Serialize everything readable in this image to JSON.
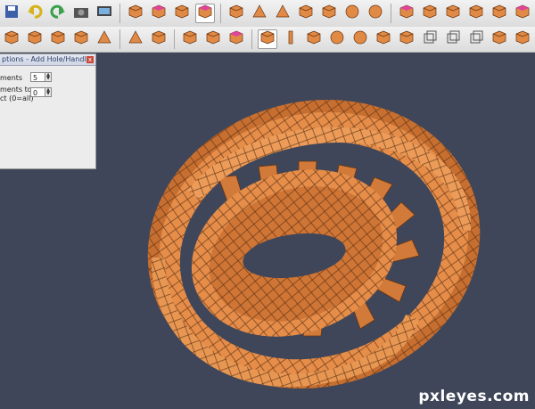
{
  "toolbar_row1": {
    "buttons": [
      {
        "name": "save-icon"
      },
      {
        "name": "undo-icon"
      },
      {
        "name": "redo-icon"
      },
      {
        "name": "camera-icon"
      },
      {
        "name": "display-icon"
      },
      {
        "name": "cube-tool-1-icon"
      },
      {
        "name": "cube-pink-icon"
      },
      {
        "name": "cube-tool-2-icon"
      },
      {
        "name": "cube-selected-icon",
        "active": true
      },
      {
        "name": "box-icon"
      },
      {
        "name": "pyramid-icon"
      },
      {
        "name": "tetrahedron-icon"
      },
      {
        "name": "pentagon-icon"
      },
      {
        "name": "dodecahedron-icon"
      },
      {
        "name": "sphere-icon"
      },
      {
        "name": "sphere-dark-icon"
      },
      {
        "name": "pink-cube-icon"
      },
      {
        "name": "bevel-icon"
      },
      {
        "name": "pentagon-prism-icon"
      },
      {
        "name": "cube-small-icon"
      },
      {
        "name": "cube-group-icon"
      },
      {
        "name": "hexagon-pink-icon"
      },
      {
        "name": "hex-icon"
      }
    ]
  },
  "toolbar_row2": {
    "buttons": [
      {
        "name": "extrude-icon"
      },
      {
        "name": "bevel-shape-icon"
      },
      {
        "name": "chamfer-icon"
      },
      {
        "name": "wedge-icon"
      },
      {
        "name": "pyramid-2-icon"
      },
      {
        "name": "tetra-2-icon"
      },
      {
        "name": "barrel-icon"
      },
      {
        "name": "cut-cube-icon"
      },
      {
        "name": "slant-cube-icon"
      },
      {
        "name": "pink-top-cube-icon"
      },
      {
        "name": "stairs-icon",
        "active": true
      },
      {
        "name": "bar-icon"
      },
      {
        "name": "half-cube-icon"
      },
      {
        "name": "torus-icon"
      },
      {
        "name": "spiral-icon"
      },
      {
        "name": "rounded-cube-icon"
      },
      {
        "name": "holes-cube-icon"
      },
      {
        "name": "wire-cube-icon"
      },
      {
        "name": "wire-cube-2-icon"
      },
      {
        "name": "wire-cube-3-icon"
      },
      {
        "name": "dark-cube-icon"
      },
      {
        "name": "dark-cube-2-icon"
      },
      {
        "name": "gear-icon"
      }
    ]
  },
  "panel": {
    "title": "ptions - Add Hole/Handle",
    "close": "x",
    "field1_label": "ments",
    "field1_value": "5",
    "field2_label_line1": "ments to",
    "field2_label_line2": "ct (0=all)",
    "field2_value": "0"
  },
  "watermark": "pxleyes.com",
  "colors": {
    "accent": "#e08a45",
    "pink": "#e0449a",
    "viewport": "#3f4659"
  }
}
